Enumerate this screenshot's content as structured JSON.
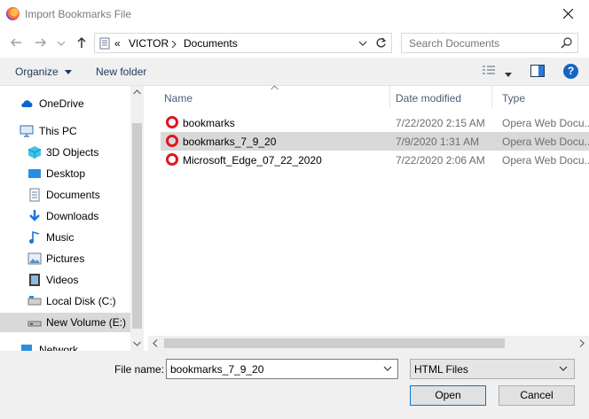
{
  "window": {
    "title": "Import Bookmarks File"
  },
  "address": {
    "overflow": "«",
    "crumbs": [
      "VICTOR",
      "Documents"
    ]
  },
  "search": {
    "placeholder": "Search Documents"
  },
  "toolbar": {
    "organize_label": "Organize",
    "new_folder_label": "New folder"
  },
  "nav": {
    "items": [
      {
        "label": "OneDrive",
        "icon": "cloud-icon",
        "level": 0
      },
      {
        "label": "This PC",
        "icon": "computer-icon",
        "level": 0
      },
      {
        "label": "3D Objects",
        "icon": "cube-icon",
        "level": 1
      },
      {
        "label": "Desktop",
        "icon": "desktop-icon",
        "level": 1
      },
      {
        "label": "Documents",
        "icon": "document-icon",
        "level": 1
      },
      {
        "label": "Downloads",
        "icon": "download-icon",
        "level": 1
      },
      {
        "label": "Music",
        "icon": "music-icon",
        "level": 1
      },
      {
        "label": "Pictures",
        "icon": "picture-icon",
        "level": 1
      },
      {
        "label": "Videos",
        "icon": "video-icon",
        "level": 1
      },
      {
        "label": "Local Disk (C:)",
        "icon": "drive-icon",
        "level": 1
      },
      {
        "label": "New Volume (E:)",
        "icon": "drive-icon",
        "level": 1,
        "selected": true
      },
      {
        "label": "Network",
        "icon": "network-icon",
        "level": 0
      }
    ]
  },
  "files": {
    "columns": {
      "name": "Name",
      "date": "Date modified",
      "type": "Type"
    },
    "rows": [
      {
        "name": "bookmarks",
        "date": "7/22/2020 2:15 AM",
        "type": "Opera Web Docu...",
        "selected": false
      },
      {
        "name": "bookmarks_7_9_20",
        "date": "7/9/2020 1:31 AM",
        "type": "Opera Web Docu...",
        "selected": true
      },
      {
        "name": "Microsoft_Edge_07_22_2020",
        "date": "7/22/2020 2:06 AM",
        "type": "Opera Web Docu...",
        "selected": false
      }
    ]
  },
  "bottom": {
    "file_name_label": "File name:",
    "file_name_value": "bookmarks_7_9_20",
    "filter_value": "HTML Files",
    "open_label": "Open",
    "cancel_label": "Cancel"
  },
  "colors": {
    "selection": "#d9d9d9",
    "toolbar_bg": "#f0f0f0",
    "opera_red": "#e0161f",
    "accent": "#0078d7"
  }
}
